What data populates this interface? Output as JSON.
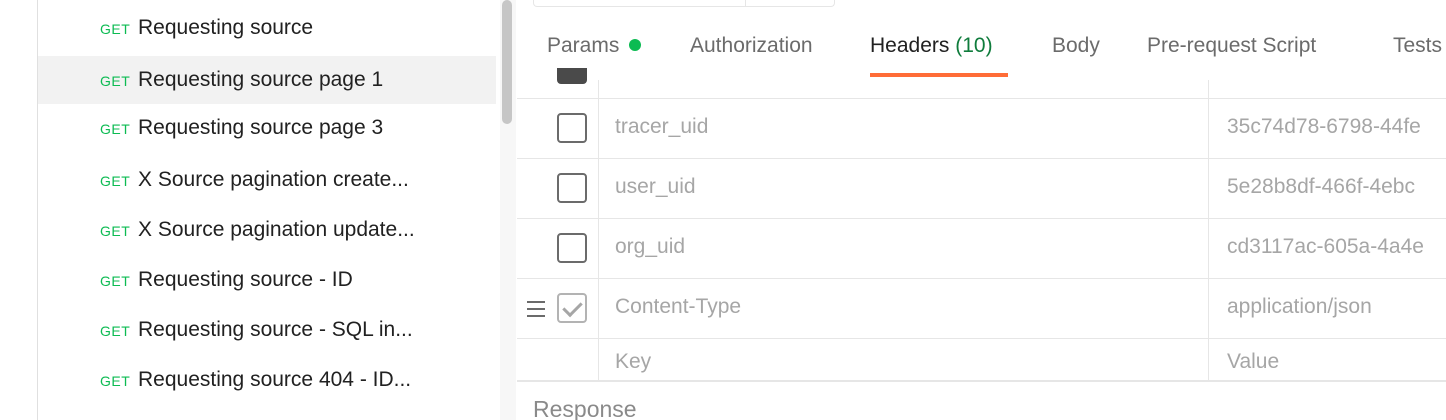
{
  "sidebar": {
    "requests": [
      {
        "method": "GET",
        "name": "Requesting source"
      },
      {
        "method": "GET",
        "name": "Requesting source page 1"
      },
      {
        "method": "GET",
        "name": "Requesting source page 3"
      },
      {
        "method": "GET",
        "name": "X Source pagination create..."
      },
      {
        "method": "GET",
        "name": "X Source pagination update..."
      },
      {
        "method": "GET",
        "name": "Requesting source - ID"
      },
      {
        "method": "GET",
        "name": "Requesting source - SQL in..."
      },
      {
        "method": "GET",
        "name": "Requesting source 404 - ID..."
      }
    ]
  },
  "tabs": {
    "params": "Params",
    "authorization": "Authorization",
    "headers": "Headers",
    "headers_count": "(10)",
    "body": "Body",
    "prerequest": "Pre-request Script",
    "tests": "Tests"
  },
  "headers_table": {
    "rows": [
      {
        "key": "tracer_uid",
        "value": "35c74d78-6798-44fe",
        "checked": false
      },
      {
        "key": "user_uid",
        "value": "5e28b8df-466f-4ebc",
        "checked": false
      },
      {
        "key": "org_uid",
        "value": "cd3117ac-605a-4a4e",
        "checked": false
      },
      {
        "key": "Content-Type",
        "value": "application/json",
        "checked": true
      }
    ],
    "key_placeholder": "Key",
    "value_placeholder": "Value"
  },
  "response": {
    "label": "Response"
  },
  "colors": {
    "accent": "#ff6c37",
    "get_method": "#0cbb52",
    "status_dot": "#0cbb52"
  }
}
